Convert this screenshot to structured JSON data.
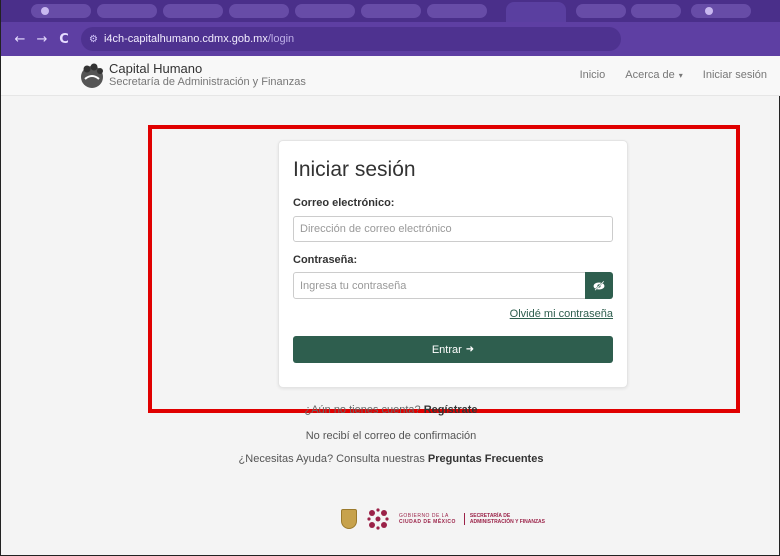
{
  "browser": {
    "nav": {
      "back": "←",
      "forward": "→",
      "reload": "C"
    },
    "url": {
      "host": "i4ch-capitalhumano.cdmx.gob.mx",
      "path": "/login"
    }
  },
  "site": {
    "brand_title": "Capital Humano",
    "brand_subtitle": "Secretaría de Administración y Finanzas",
    "nav": {
      "inicio": "Inicio",
      "acerca": "Acerca de",
      "login": "Iniciar sesión"
    }
  },
  "login": {
    "title": "Iniciar sesión",
    "email_label": "Correo electrónico:",
    "email_placeholder": "Dirección de correo electrónico",
    "email_value": "",
    "password_label": "Contraseña:",
    "password_placeholder": "Ingresa tu contraseña",
    "password_value": "",
    "forgot_link": "Olvidé mi contraseña",
    "submit_label": "Entrar"
  },
  "below": {
    "register_prefix": "¿Aún no tienes cuenta?",
    "register_link": "Regístrate",
    "confirm_email": "No recibí el correo de confirmación",
    "help_prefix": "¿Necesitas Ayuda? Consulta nuestras",
    "help_link": "Preguntas Frecuentes"
  },
  "footer": {
    "gob_line1": "GOBIERNO DE LA",
    "gob_line2": "CIUDAD DE MÉXICO",
    "sec_line1": "SECRETARÍA DE",
    "sec_line2": "ADMINISTRACIÓN Y FINANZAS"
  },
  "icons": {
    "eye": "eye-slash-icon",
    "enter": "sign-in-icon"
  },
  "colors": {
    "primary": "#2e5e4e",
    "highlight": "#e00000",
    "browser_chrome": "#5e3fa3",
    "guinda": "#9b2248"
  }
}
